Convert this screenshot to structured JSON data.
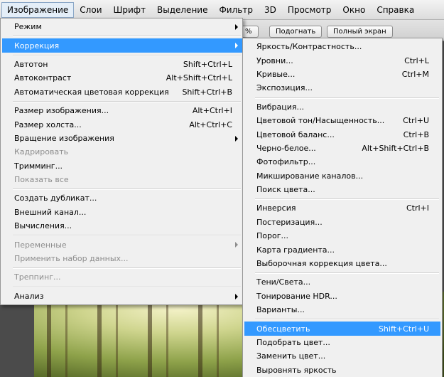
{
  "menubar": {
    "items": [
      {
        "label": "Изображение",
        "active": true
      },
      {
        "label": "Слои"
      },
      {
        "label": "Шрифт"
      },
      {
        "label": "Выделение"
      },
      {
        "label": "Фильтр"
      },
      {
        "label": "3D"
      },
      {
        "label": "Просмотр"
      },
      {
        "label": "Окно"
      },
      {
        "label": "Справка"
      }
    ]
  },
  "optionsbar": {
    "partial_label": "%",
    "fit_label": "Подогнать",
    "fullscreen_label": "Полный экран"
  },
  "image_menu": {
    "items": [
      {
        "label": "Режим",
        "submenu": true
      },
      {
        "sep": true
      },
      {
        "label": "Коррекция",
        "submenu": true,
        "highlight": true
      },
      {
        "sep": true
      },
      {
        "label": "Автотон",
        "shortcut": "Shift+Ctrl+L"
      },
      {
        "label": "Автоконтраст",
        "shortcut": "Alt+Shift+Ctrl+L"
      },
      {
        "label": "Автоматическая цветовая коррекция",
        "shortcut": "Shift+Ctrl+B"
      },
      {
        "sep": true
      },
      {
        "label": "Размер изображения...",
        "shortcut": "Alt+Ctrl+I"
      },
      {
        "label": "Размер холста...",
        "shortcut": "Alt+Ctrl+C"
      },
      {
        "label": "Вращение изображения",
        "submenu": true
      },
      {
        "label": "Кадрировать",
        "disabled": true
      },
      {
        "label": "Тримминг..."
      },
      {
        "label": "Показать все",
        "disabled": true
      },
      {
        "sep": true
      },
      {
        "label": "Создать дубликат..."
      },
      {
        "label": "Внешний канал..."
      },
      {
        "label": "Вычисления..."
      },
      {
        "sep": true
      },
      {
        "label": "Переменные",
        "submenu": true,
        "disabled": true
      },
      {
        "label": "Применить набор данных...",
        "disabled": true
      },
      {
        "sep": true
      },
      {
        "label": "Треппинг...",
        "disabled": true
      },
      {
        "sep": true
      },
      {
        "label": "Анализ",
        "submenu": true
      }
    ]
  },
  "correction_menu": {
    "items": [
      {
        "label": "Яркость/Контрастность..."
      },
      {
        "label": "Уровни...",
        "shortcut": "Ctrl+L"
      },
      {
        "label": "Кривые...",
        "shortcut": "Ctrl+M"
      },
      {
        "label": "Экспозиция..."
      },
      {
        "sep": true
      },
      {
        "label": "Вибрация..."
      },
      {
        "label": "Цветовой тон/Насыщенность...",
        "shortcut": "Ctrl+U"
      },
      {
        "label": "Цветовой баланс...",
        "shortcut": "Ctrl+B"
      },
      {
        "label": "Черно-белое...",
        "shortcut": "Alt+Shift+Ctrl+B"
      },
      {
        "label": "Фотофильтр..."
      },
      {
        "label": "Микширование каналов..."
      },
      {
        "label": "Поиск цвета..."
      },
      {
        "sep": true
      },
      {
        "label": "Инверсия",
        "shortcut": "Ctrl+I"
      },
      {
        "label": "Постеризация..."
      },
      {
        "label": "Порог..."
      },
      {
        "label": "Карта градиента..."
      },
      {
        "label": "Выборочная коррекция цвета..."
      },
      {
        "sep": true
      },
      {
        "label": "Тени/Света..."
      },
      {
        "label": "Тонирование HDR..."
      },
      {
        "label": "Варианты..."
      },
      {
        "sep": true
      },
      {
        "label": "Обесцветить",
        "shortcut": "Shift+Ctrl+U",
        "highlight": true
      },
      {
        "label": "Подобрать цвет..."
      },
      {
        "label": "Заменить цвет..."
      },
      {
        "label": "Выровнять яркость"
      }
    ]
  },
  "colors": {
    "highlight": "#3399ff",
    "menu_bg": "#f0f0f0",
    "disabled_text": "#8d8d8d"
  }
}
